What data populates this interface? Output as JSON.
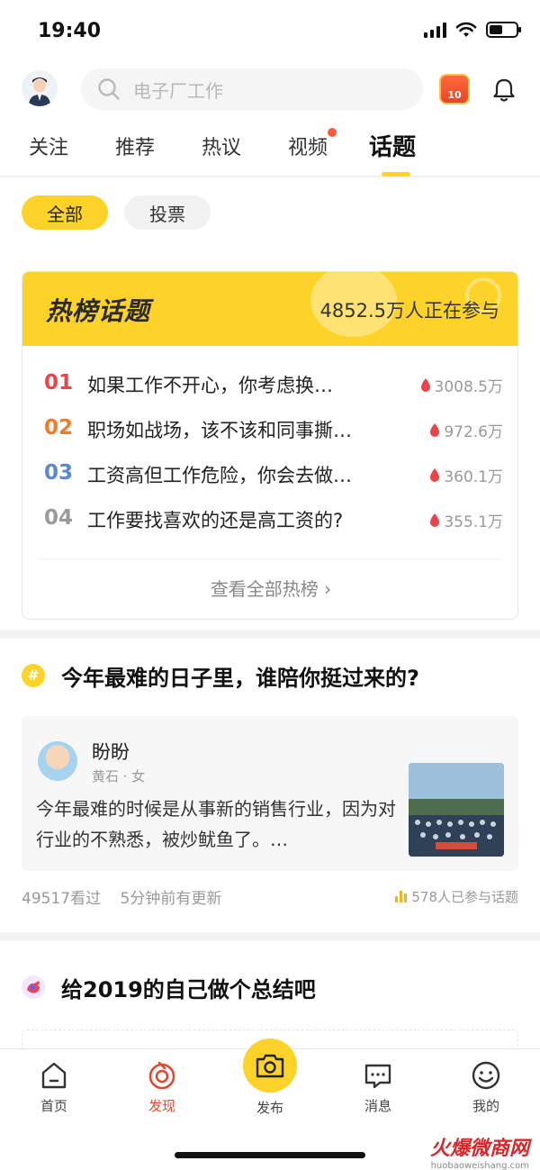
{
  "status_bar": {
    "time": "19:40"
  },
  "search": {
    "placeholder": "电子厂工作"
  },
  "coin_badge": {
    "value": "10"
  },
  "tabs": [
    {
      "label": "关注",
      "active": false
    },
    {
      "label": "推荐",
      "active": false
    },
    {
      "label": "热议",
      "active": false
    },
    {
      "label": "视频",
      "active": false,
      "dot": true
    },
    {
      "label": "话题",
      "active": true
    }
  ],
  "filters": [
    {
      "label": "全部",
      "active": true
    },
    {
      "label": "投票",
      "active": false
    }
  ],
  "hot_list": {
    "title": "热榜话题",
    "participants": "4852.5万人正在参与",
    "items": [
      {
        "rank": "01",
        "rank_color": "#e8454a",
        "text": "如果工作不开心，你考虑换…",
        "heat": "3008.5万"
      },
      {
        "rank": "02",
        "rank_color": "#f07b2c",
        "text": "职场如战场，该不该和同事撕…",
        "heat": "972.6万"
      },
      {
        "rank": "03",
        "rank_color": "#5b86d6",
        "text": "工资高但工作危险，你会去做…",
        "heat": "360.1万"
      },
      {
        "rank": "04",
        "rank_color": "#9a9a9a",
        "text": "工作要找喜欢的还是高工资的?",
        "heat": "355.1万"
      }
    ],
    "more_label": "查看全部热榜 ›"
  },
  "topic": {
    "badge": "#",
    "title": "今年最难的日子里，谁陪你挺过来的?",
    "post": {
      "author": "盼盼",
      "meta": "黄石 · 女",
      "text": "今年最难的时候是从事新的销售行业，因为对行业的不熟悉，被炒鱿鱼了。…"
    },
    "views": "49517看过",
    "updated": "5分钟前有更新",
    "joined": "578人已参与话题"
  },
  "topic2": {
    "title": "给2019的自己做个总结吧"
  },
  "bottom_nav": [
    {
      "label": "首页",
      "icon": "home-icon",
      "active": false
    },
    {
      "label": "发现",
      "icon": "discover-icon",
      "active": true
    },
    {
      "label": "发布",
      "icon": "camera-icon",
      "active": false
    },
    {
      "label": "消息",
      "icon": "message-icon",
      "active": false
    },
    {
      "label": "我的",
      "icon": "profile-icon",
      "active": false
    }
  ],
  "watermark": {
    "main": "火爆微商网",
    "sub": "huobaoweishang.com"
  },
  "colors": {
    "accent": "#fdd329",
    "active_nav": "#e24a2f",
    "heat": "#e8454a"
  }
}
